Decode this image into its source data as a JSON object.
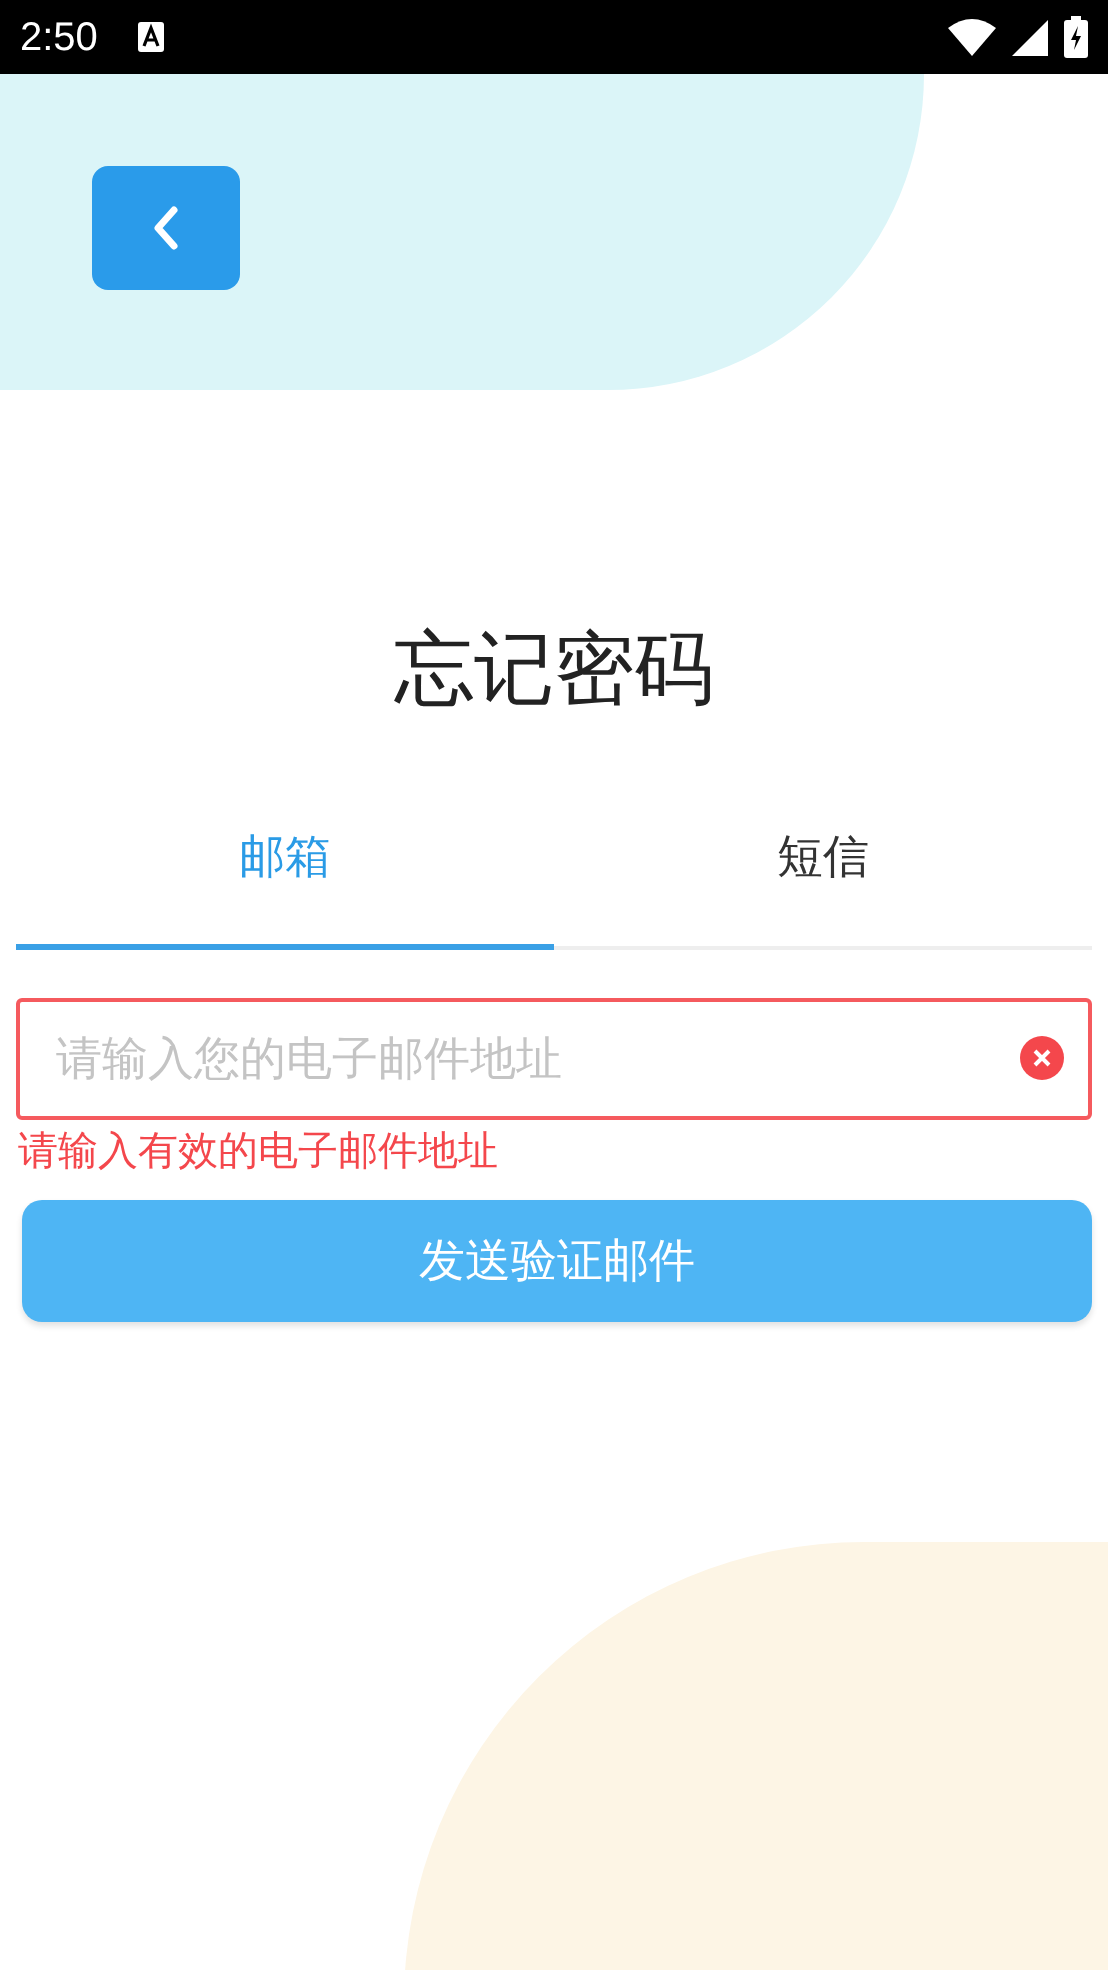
{
  "status_bar": {
    "time": "2:50"
  },
  "title": "忘记密码",
  "tabs": [
    {
      "label": "邮箱",
      "selected": true
    },
    {
      "label": "短信",
      "selected": false
    }
  ],
  "email_field": {
    "placeholder": "请输入您的电子邮件地址",
    "invalid": true
  },
  "error_message": "请输入有效的电子邮件地址",
  "send_button": "发送验证邮件"
}
